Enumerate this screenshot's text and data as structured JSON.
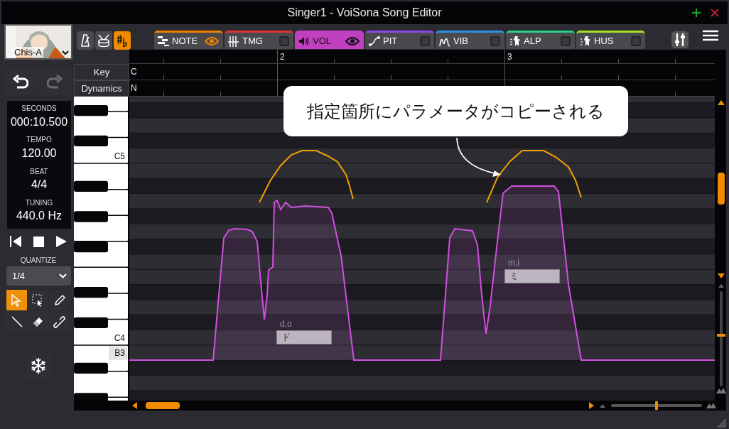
{
  "window": {
    "title": "Singer1 - VoiSona Song Editor"
  },
  "singer": {
    "name": "Chis-A"
  },
  "toggles": [
    {
      "on": false
    },
    {
      "on": false
    },
    {
      "on": true
    }
  ],
  "tabs": [
    {
      "label": "NOTE",
      "color": "#f08000",
      "selected": false,
      "visible": true
    },
    {
      "label": "TMG",
      "color": "#e03030",
      "selected": false,
      "visible": false
    },
    {
      "label": "VOL",
      "color": "#c040c0",
      "selected": true,
      "visible": true
    },
    {
      "label": "PIT",
      "color": "#8848e8",
      "selected": false,
      "visible": false
    },
    {
      "label": "VIB",
      "color": "#3090e8",
      "selected": false,
      "visible": false
    },
    {
      "label": "ALP",
      "color": "#28d088",
      "selected": false,
      "visible": false
    },
    {
      "label": "HUS",
      "color": "#a8e028",
      "selected": false,
      "visible": false
    }
  ],
  "history": [
    {
      "disabled": false
    },
    {
      "disabled": true
    }
  ],
  "info": [
    {
      "label": "SECONDS",
      "value": "000:10.500"
    },
    {
      "label": "TEMPO",
      "value": "120.00"
    },
    {
      "label": "BEAT",
      "value": "4/4"
    },
    {
      "label": "TUNING",
      "value": "440.0 Hz"
    }
  ],
  "quantize": {
    "label": "QUANTIZE",
    "value": "1/4"
  },
  "tools": [
    {
      "selected": true
    },
    {
      "selected": false
    },
    {
      "selected": false
    },
    {
      "selected": false
    },
    {
      "selected": false
    },
    {
      "selected": false
    }
  ],
  "ruler": {
    "bars": [
      "2",
      "3"
    ]
  },
  "rows": [
    {
      "label": "Key",
      "value": "C"
    },
    {
      "label": "Dynamics",
      "value": "N"
    }
  ],
  "piano_keys": [
    {
      "label": "C5",
      "highlighted": false
    },
    {
      "label": "C4",
      "highlighted": false
    },
    {
      "label": "B3",
      "highlighted": true
    }
  ],
  "notes": [
    {
      "lyric": "ド",
      "phonemes": "d,o"
    },
    {
      "lyric": "ミ",
      "phonemes": "m,i"
    }
  ],
  "callout": {
    "text": "指定箇所にパラメータがコピーされる"
  },
  "zoom": {
    "horizontal": {
      "level": 0.5
    },
    "vertical": {
      "level": 0.54
    }
  }
}
